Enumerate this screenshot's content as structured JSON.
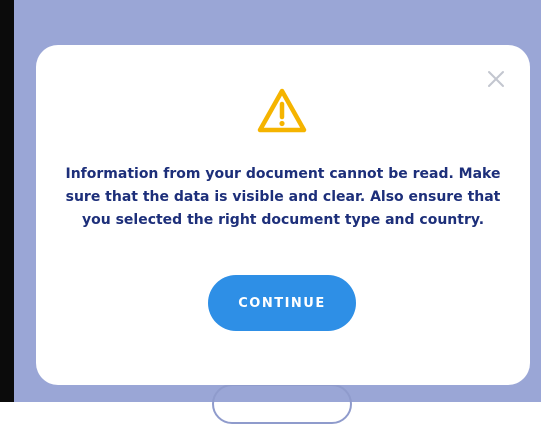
{
  "dialog": {
    "icon": "warning-triangle-icon",
    "message": "Information from your document cannot be read. Make sure that the data is visible and clear. Also ensure that you selected the right document type and country.",
    "continue_label": "CONTINUE",
    "close_icon": "close-icon"
  },
  "colors": {
    "backdrop": "#9aa6d6",
    "accent": "#2e8fe6",
    "warning": "#f5b400",
    "text": "#1d2f7a"
  }
}
